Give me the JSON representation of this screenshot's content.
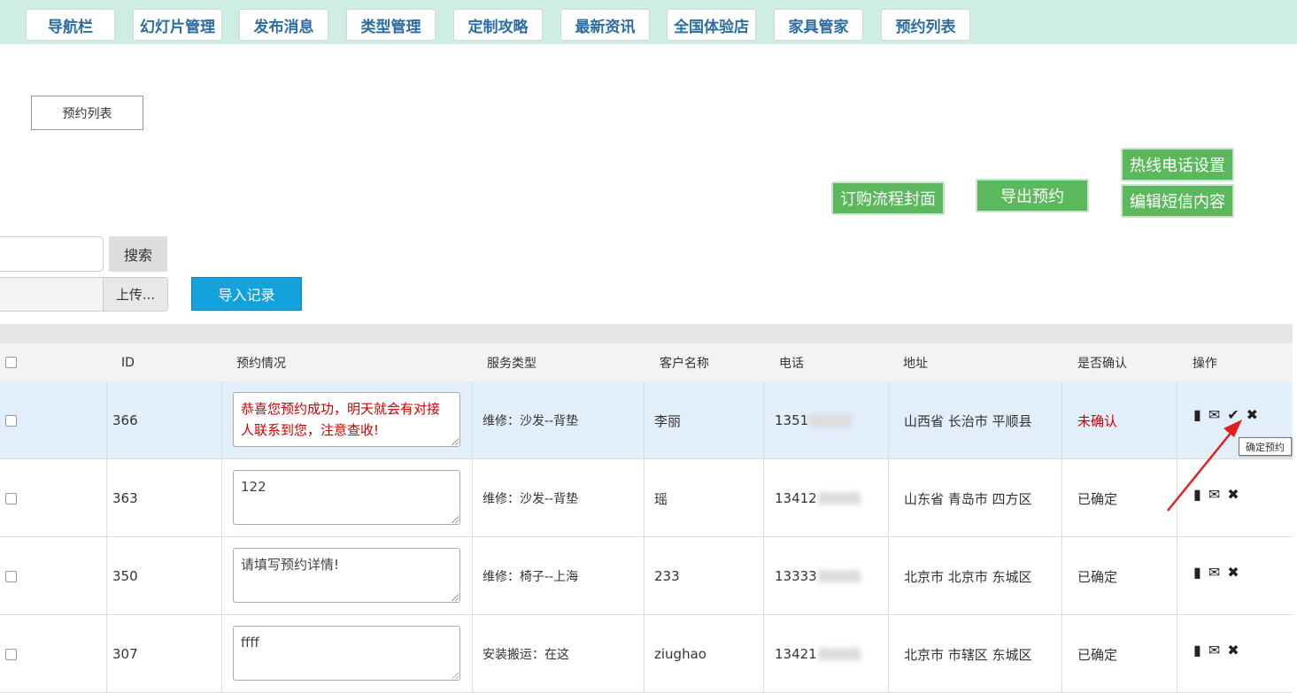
{
  "nav": [
    "导航栏",
    "幻灯片管理",
    "发布消息",
    "类型管理",
    "定制攻略",
    "最新资讯",
    "全国体验店",
    "家具管家",
    "预约列表"
  ],
  "tab_label": "预约列表",
  "actions": {
    "hotline": "热线电话设置",
    "order_cover": "订购流程封面",
    "export": "导出预约",
    "sms": "编辑短信内容"
  },
  "search": {
    "button": "搜索",
    "value": ""
  },
  "upload": {
    "button": "上传...",
    "import": "导入记录"
  },
  "table": {
    "headers": [
      "ID",
      "预约情况",
      "服务类型",
      "客户名称",
      "电话",
      "地址",
      "是否确认",
      "操作"
    ],
    "rows": [
      {
        "id": "366",
        "note": "恭喜您预约成功，明天就会有对接人联系到您，注意查收!",
        "service": "维修：沙发--背垫",
        "customer": "李丽",
        "phone_prefix": "1351",
        "address": "山西省 长治市 平顺县",
        "status": "未确认"
      },
      {
        "id": "363",
        "note": "122",
        "service": "维修：沙发--背垫",
        "customer": "瑶",
        "phone_prefix": "13412",
        "address": "山东省 青岛市 四方区",
        "status": "已确定"
      },
      {
        "id": "350",
        "note": "请填写预约详情!",
        "service": "维修：椅子--上海",
        "customer": "233",
        "phone_prefix": "13333",
        "address": "北京市 北京市 东城区",
        "status": "已确定"
      },
      {
        "id": "307",
        "note": "ffff",
        "service": "安装搬运：在这",
        "customer": "ziughao",
        "phone_prefix": "13421",
        "address": "北京市 市辖区 东城区",
        "status": "已确定"
      }
    ]
  },
  "tooltip": "确定预约",
  "colors": {
    "unconfirmed": "#cc0000",
    "topbar": "#cfeee3",
    "green_button": "#5cb85c",
    "import_button": "#15a1dc",
    "arrow": "#e02020"
  },
  "icons": [
    "file-icon",
    "envelope-icon",
    "check-icon",
    "close-icon"
  ]
}
